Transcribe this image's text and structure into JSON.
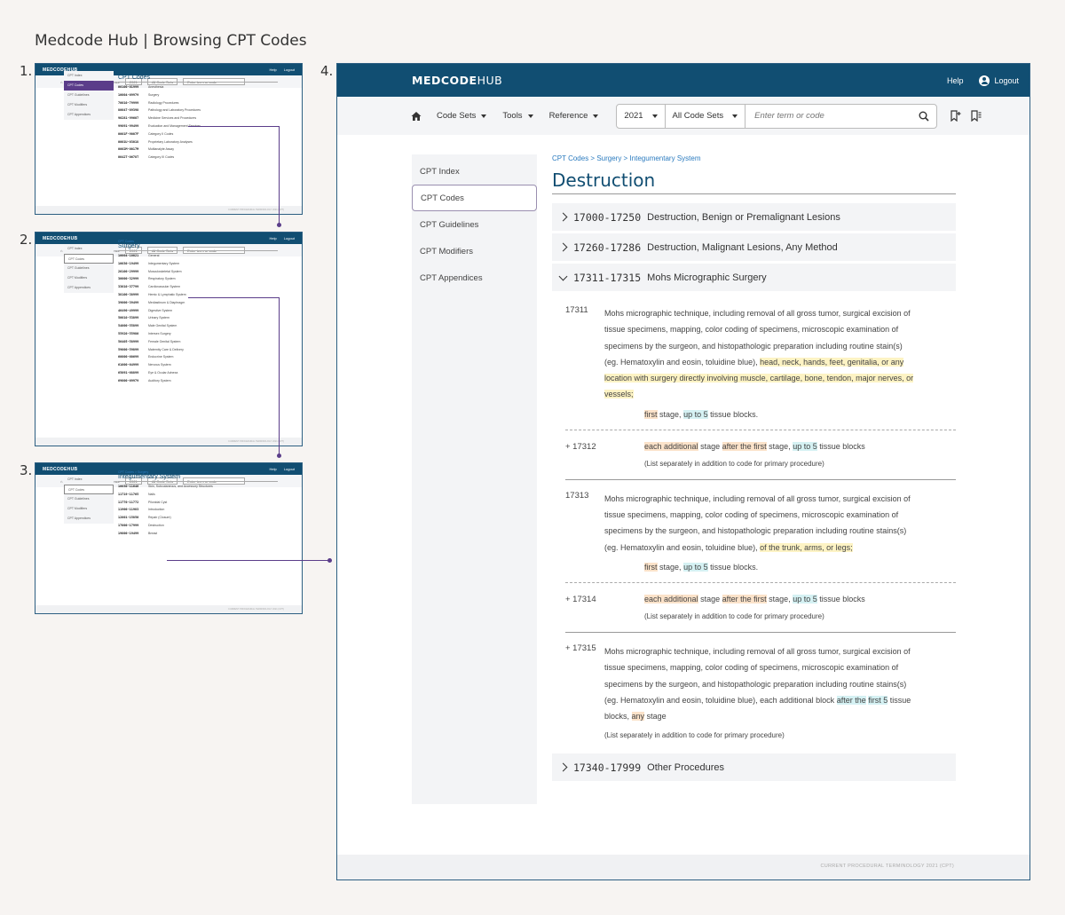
{
  "page_title": "Medcode Hub | Browsing CPT Codes",
  "steps": [
    "1.",
    "2.",
    "3.",
    "4."
  ],
  "app": {
    "logo_bold": "MEDCODE",
    "logo_light": "HUB",
    "help": "Help",
    "logout": "Logout"
  },
  "toolbar": {
    "code_sets": "Code Sets",
    "tools": "Tools",
    "reference": "Reference",
    "year": "2021",
    "code_set_filter": "All Code Sets",
    "search_placeholder": "Enter term or code"
  },
  "sidebar": [
    "CPT Index",
    "CPT Codes",
    "CPT Guidelines",
    "CPT Modifiers",
    "CPT Appendices"
  ],
  "footer": "CURRENT PROCEDURAL TERMINOLOGY 2021 (CPT)",
  "mini1": {
    "title": "CPT Codes",
    "rows": [
      {
        "code": "00100-01999",
        "label": "Anesthesia"
      },
      {
        "code": "10004-69979",
        "label": "Surgery"
      },
      {
        "code": "70010-79999",
        "label": "Radiology Procedures"
      },
      {
        "code": "80047-89398",
        "label": "Pathology and Laboratory Procedures"
      },
      {
        "code": "90281-99607",
        "label": "Medicine Services and Procedures"
      },
      {
        "code": "99091-99499",
        "label": "Evaluation and Management Services"
      },
      {
        "code": "0001F-9007F",
        "label": "Category II Codes"
      },
      {
        "code": "0001U-0301U",
        "label": "Proprietary Laboratory Analyses"
      },
      {
        "code": "0002M-0017M",
        "label": "Multianalyte Assay"
      },
      {
        "code": "0042T-0678T",
        "label": "Category III Codes"
      }
    ]
  },
  "mini2": {
    "crumb": "CPT Codes",
    "title": "Surgery",
    "rows": [
      {
        "code": "10004-10021",
        "label": "General"
      },
      {
        "code": "10030-19499",
        "label": "Integumentary System"
      },
      {
        "code": "20100-29999",
        "label": "Musculoskeletal System"
      },
      {
        "code": "30000-32999",
        "label": "Respiratory System"
      },
      {
        "code": "33010-37799",
        "label": "Cardiovascular System"
      },
      {
        "code": "38100-38999",
        "label": "Hemic & Lymphatic System"
      },
      {
        "code": "39000-39499",
        "label": "Mediastinum & Diaphragm"
      },
      {
        "code": "40490-49999",
        "label": "Digestive System"
      },
      {
        "code": "50010-53899",
        "label": "Urinary System"
      },
      {
        "code": "54000-55899",
        "label": "Male Genital System"
      },
      {
        "code": "55920-55980",
        "label": "Intersex Surgery"
      },
      {
        "code": "56405-58999",
        "label": "Female Genital System"
      },
      {
        "code": "59000-59899",
        "label": "Maternity Care & Delivery"
      },
      {
        "code": "60000-60699",
        "label": "Endocrine System"
      },
      {
        "code": "61000-64999",
        "label": "Nervous System"
      },
      {
        "code": "65091-68899",
        "label": "Eye & Ocular Adnexa"
      },
      {
        "code": "69000-69979",
        "label": "Auditory System"
      }
    ]
  },
  "mini3": {
    "crumb": "CPT Codes > Surgery",
    "title": "Integumentary System",
    "rows": [
      {
        "code": "10030-11646",
        "label": "Skin, Subcutaneous, and Accessory Structures"
      },
      {
        "code": "11719-11765",
        "label": "Nails"
      },
      {
        "code": "11770-11772",
        "label": "Pilonidal Cyst"
      },
      {
        "code": "11900-11983",
        "label": "Introduction"
      },
      {
        "code": "12001-15850",
        "label": "Repair (Closure)"
      },
      {
        "code": "17000-17999",
        "label": "Destruction"
      },
      {
        "code": "19000-19499",
        "label": "Breast"
      }
    ]
  },
  "main": {
    "breadcrumb": "CPT Codes > Surgery > Integumentary System",
    "title": "Destruction",
    "sections": [
      {
        "range": "17000-17250",
        "label": "Destruction, Benign or Premalignant Lesions"
      },
      {
        "range": "17260-17286",
        "label": "Destruction, Malignant Lesions, Any Method"
      },
      {
        "range": "17311-17315",
        "label": "Mohs Micrographic Surgery"
      },
      {
        "range": "17340-17999",
        "label": "Other Procedures"
      }
    ],
    "codes": {
      "c17311": "17311",
      "c17312": "+ 17312",
      "c17313": "17313",
      "c17314": "+ 17314",
      "c17315": "+ 17315"
    },
    "text": {
      "mohs_intro": "Mohs micrographic technique, including removal of all gross tumor, surgical excision of tissue specimens, mapping, color coding of specimens, microscopic examination of specimens by the surgeon, and histopathologic preparation including routine",
      "stain_s": "stain(s) (eg. Hematoxylin and eosin, toluidine blue),",
      "stains": "stains(s) (eg. Hematoxylin and eosin, toluidine blue),",
      "head_neck": "head, neck, hands, feet, genitalia, or any location with surgery directly involving muscle, cartilage, bone, tendon, major nerves, or vessels;",
      "trunk": "of the trunk, arms, or legs;",
      "first": "first",
      "stage_comma": "stage,",
      "stage": "stage",
      "up_to_5": "up to 5",
      "tissue_blocks_dot": "tissue blocks.",
      "tissue_blocks": "tissue blocks",
      "each_additional": "each additional",
      "after_the_first": "after the first",
      "list_separately": "(List separately in addition to code for primary procedure)",
      "each_additional_block": "each additional block",
      "after_the": "after the",
      "first_5": "first 5",
      "tissue_blocks_comma": "tissue blocks,",
      "any": "any"
    }
  }
}
